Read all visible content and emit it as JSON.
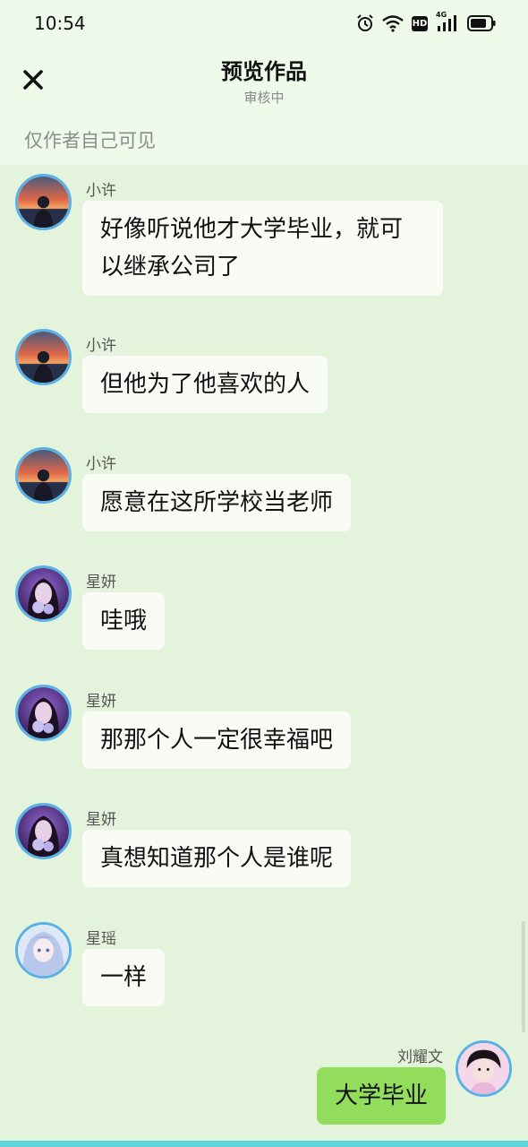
{
  "status_bar": {
    "time": "10:54",
    "icons": [
      "alarm-icon",
      "wifi-icon",
      "hd-icon",
      "signal-icon",
      "battery-icon"
    ],
    "hd_label": "HD",
    "network_label": "4G"
  },
  "header": {
    "title": "预览作品",
    "subtitle": "审核中",
    "visibility_note": "仅作者自己可见"
  },
  "colors": {
    "header_bg": "#eefaea",
    "chat_bg": "#e4f3dc",
    "bubble_bg": "#f8fcf5",
    "self_bubble_bg": "#92de5c",
    "avatar_border": "#5ab1e6"
  },
  "messages": [
    {
      "sender": "小许",
      "text": "好像听说他才大学毕业，就可以继承公司了",
      "side": "left",
      "avatar": "sunset-man"
    },
    {
      "sender": "小许",
      "text": "但他为了他喜欢的人",
      "side": "left",
      "avatar": "sunset-man"
    },
    {
      "sender": "小许",
      "text": "愿意在这所学校当老师",
      "side": "left",
      "avatar": "sunset-man"
    },
    {
      "sender": "星妍",
      "text": "哇哦",
      "side": "left",
      "avatar": "girl-purple"
    },
    {
      "sender": "星妍",
      "text": "那那个人一定很幸福吧",
      "side": "left",
      "avatar": "girl-purple"
    },
    {
      "sender": "星妍",
      "text": "真想知道那个人是谁呢",
      "side": "left",
      "avatar": "girl-purple"
    },
    {
      "sender": "星瑶",
      "text": "一样",
      "side": "left",
      "avatar": "girl-blue-illustration"
    },
    {
      "sender": "刘耀文",
      "text": "大学毕业",
      "side": "right",
      "avatar": "boy-portrait"
    }
  ]
}
